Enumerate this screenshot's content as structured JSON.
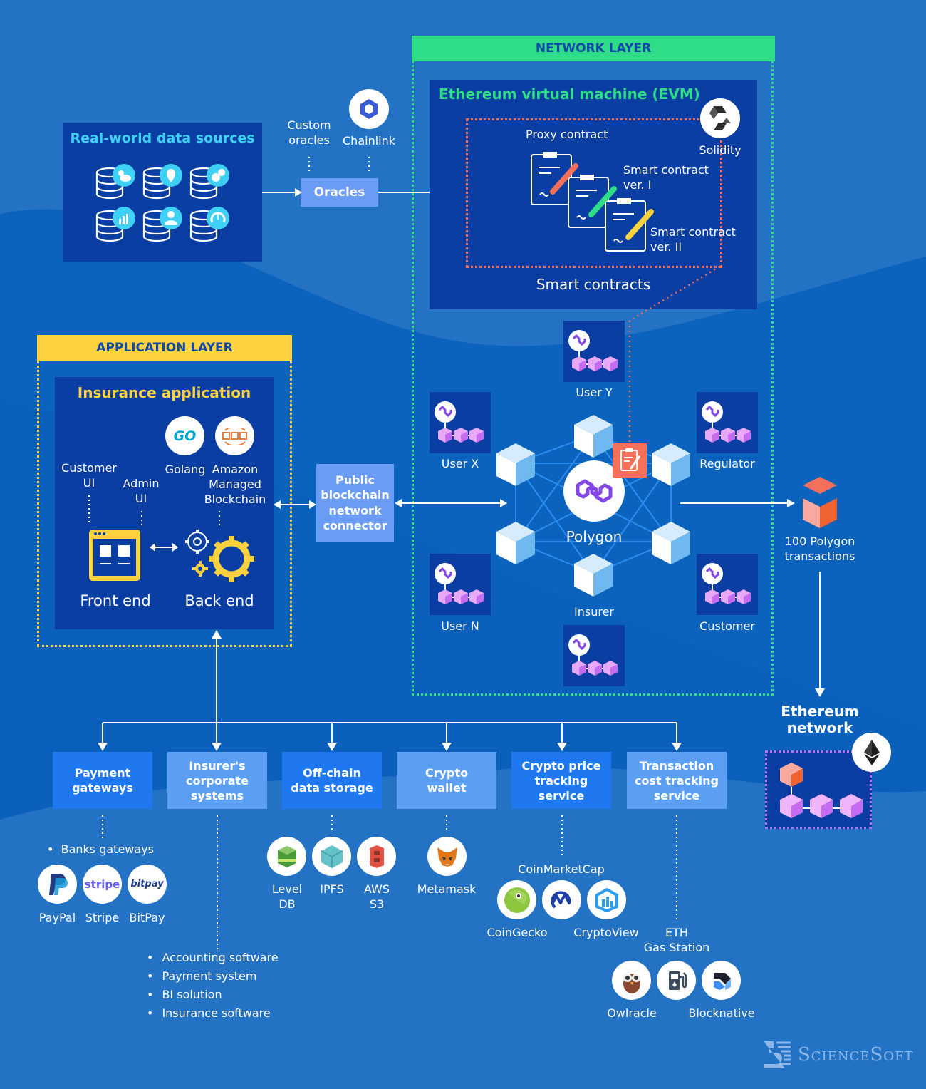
{
  "data_sources": {
    "title": "Real-world data sources",
    "icons": [
      "weather-icon",
      "location-icon",
      "coins-icon",
      "chart-icon",
      "user-icon",
      "gauge-icon"
    ]
  },
  "oracles": {
    "label": "Oracles",
    "custom_label": "Custom oracles",
    "custom_line1": "Custom",
    "custom_line2": "oracles",
    "chainlink_label": "Chainlink"
  },
  "network_layer": {
    "header": "NETWORK LAYER",
    "evm_title": "Ethereum virtual machine (EVM)",
    "solidity_label": "Solidity",
    "proxy_label": "Proxy contract",
    "sc1_line1": "Smart contract",
    "sc1_line2": "ver. I",
    "sc2_line1": "Smart contract",
    "sc2_line2": "ver. II",
    "smart_contracts_label": "Smart contracts",
    "polygon_label": "Polygon",
    "nodes": {
      "user_y": "User Y",
      "user_x": "User X",
      "regulator": "Regulator",
      "user_n": "User N",
      "customer": "Customer",
      "insurer": "Insurer"
    }
  },
  "application_layer": {
    "header": "APPLICATION LAYER",
    "app_title": "Insurance application",
    "customer_ui_1": "Customer",
    "customer_ui_2": "UI",
    "admin_ui_1": "Admin",
    "admin_ui_2": "UI",
    "golang": "Golang",
    "amb_1": "Amazon",
    "amb_2": "Managed",
    "amb_3": "Blockchain",
    "front_end": "Front end",
    "back_end": "Back end"
  },
  "connector": {
    "line1": "Public",
    "line2": "blockchain",
    "line3": "network",
    "line4": "connector"
  },
  "rollup": {
    "line1": "100 Polygon",
    "line2": "transactions",
    "eth_line1": "Ethereum",
    "eth_line2": "network"
  },
  "services": [
    {
      "l1": "Payment",
      "l2": "gateways",
      "l3": ""
    },
    {
      "l1": "Insurer's",
      "l2": "corporate",
      "l3": "systems"
    },
    {
      "l1": "Off-chain",
      "l2": "data storage",
      "l3": ""
    },
    {
      "l1": "Crypto",
      "l2": "wallet",
      "l3": ""
    },
    {
      "l1": "Crypto price",
      "l2": "tracking",
      "l3": "service"
    },
    {
      "l1": "Transaction",
      "l2": "cost tracking",
      "l3": "service"
    }
  ],
  "payment": {
    "bullet": "Banks gateways",
    "paypal": "PayPal",
    "stripe": "Stripe",
    "stripe_logo": "stripe",
    "bitpay": "BitPay",
    "bitpay_logo": "bitpay"
  },
  "corporate_list": [
    "Accounting software",
    "Payment system",
    "BI solution",
    "Insurance software"
  ],
  "storage": {
    "leveldb_1": "Level",
    "leveldb_2": "DB",
    "ipfs": "IPFS",
    "s3_1": "AWS",
    "s3_2": "S3"
  },
  "wallet": {
    "metamask": "Metamask"
  },
  "price": {
    "coinmarketcap": "CoinMarketCap",
    "coingecko": "CoinGecko",
    "cryptoview": "CryptoView"
  },
  "txcost": {
    "ethgas_1": "ETH",
    "ethgas_2": "Gas Station",
    "owlracle": "Owlracle",
    "blocknative": "Blocknative"
  },
  "brand": {
    "name": "ScienceSoft"
  },
  "colors": {
    "background": "#2472c4",
    "panel": "#0b3ea3",
    "network_green": "#2fdc87",
    "application_yellow": "#fdd23f",
    "accent_cyan": "#3ed0f5",
    "contract_orange": "#f4705a",
    "polygon_purple": "#8247e5"
  }
}
